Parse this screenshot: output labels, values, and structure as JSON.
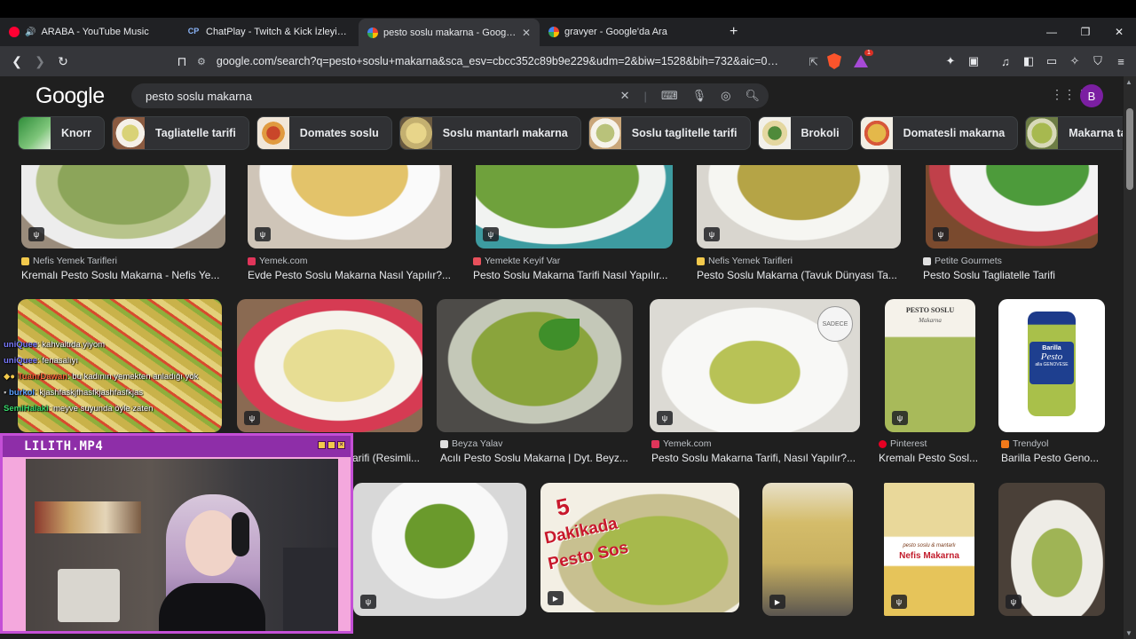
{
  "browser": {
    "tabs": [
      {
        "label": "ARABA - YouTube Music",
        "icon": "youtube-music-icon",
        "active": false
      },
      {
        "label": "ChatPlay - Twitch & Kick İzleyici Etkileşimi",
        "icon": "chatplay-icon",
        "active": false
      },
      {
        "label": "pesto soslu makarna - Google'da Ara",
        "icon": "google-icon",
        "active": true
      },
      {
        "label": "gravyer - Google'da Ara",
        "icon": "google-icon",
        "active": false
      }
    ],
    "favicon_cp": "CP",
    "new_tab": "+",
    "window_controls": {
      "minimize": "—",
      "restore": "❐",
      "close": "✕"
    },
    "url": "google.com/search?q=pesto+soslu+makarna&sca_esv=cbcc352c89b9e229&udm=2&biw=1528&bih=732&aic=0&ei=pxt...",
    "brave_badge": "4",
    "alert_badge": "1"
  },
  "google": {
    "logo": "Google",
    "query": "pesto soslu makarna",
    "avatar_letter": "B",
    "chips": [
      {
        "label": "Knorr"
      },
      {
        "label": "Tagliatelle tarifi"
      },
      {
        "label": "Domates soslu"
      },
      {
        "label": "Soslu mantarlı makarna"
      },
      {
        "label": "Soslu taglitelle tarifi"
      },
      {
        "label": "Brokoli"
      },
      {
        "label": "Domatesli makarna"
      },
      {
        "label": "Makarna tarifler"
      }
    ],
    "row1": [
      {
        "source": "Nefis Yemek Tarifleri",
        "title": "Kremalı Pesto Soslu Makarna - Nefis Ye..."
      },
      {
        "source": "Yemek.com",
        "title": "Evde Pesto Soslu Makarna Nasıl Yapılır?..."
      },
      {
        "source": "Yemekte Keyif Var",
        "title": "Pesto Soslu Makarna Tarifi Nasıl Yapılır..."
      },
      {
        "source": "Nefis Yemek Tarifleri",
        "title": "Pesto Soslu Makarna (Tavuk Dünyası Ta..."
      },
      {
        "source": "Petite Gourmets",
        "title": "Pesto Soslu Tagliatelle Tarifi"
      }
    ],
    "row2": [
      {
        "source": "",
        "title": ""
      },
      {
        "source": "",
        "title": "arifi (Resimli..."
      },
      {
        "source": "Beyza Yalav",
        "title": "Acılı Pesto Soslu Makarna | Dyt. Beyz..."
      },
      {
        "source": "Yemek.com",
        "title": "Pesto Soslu Makarna Tarifi, Nasıl Yapılır?..."
      },
      {
        "source": "Pinterest",
        "title": "Kremalı Pesto Sosl..."
      },
      {
        "source": "Trendyol",
        "title": "Barilla Pesto Geno..."
      }
    ],
    "image_text": {
      "sade_badge": "SADECE",
      "pesto_book_title": "PESTO SOSLU",
      "pesto_book_sub": "Makarna",
      "barilla": "Barilla",
      "barilla_pesto": "Pesto",
      "barilla_genovese": "alla GENOVESE",
      "video_5dk_a": "5",
      "video_5dk_b": "Dakikada",
      "video_5dk_c": "Pesto Sos",
      "mantarli_a": "pesto soslu & mantarlı",
      "mantarli_b": "Nefis Makarna"
    }
  },
  "chat": [
    {
      "user": "uniQuee",
      "message": "kahvaltıda yiyom",
      "color": "#7b7bff"
    },
    {
      "user": "uniQuee",
      "message": "fenasalıyı",
      "color": "#7b7bff"
    },
    {
      "user": "TuanrDawan",
      "message": "bu kadının yemekten anladığı yok",
      "color": "#ff6a3d"
    },
    {
      "user": "burkol",
      "message": "kjashfaskjfhasfkjashfasfkjas",
      "color": "#5aa0ff"
    },
    {
      "user": "SemiHalaki",
      "message": "meyve suyunda öyle zaten",
      "color": "#38d96b"
    }
  ],
  "cam": {
    "title": "LILITH.MP4"
  },
  "colors": {
    "accent": "#8ab4f8",
    "cam_border": "#c44fd6",
    "cam_title": "#8e2ea8",
    "cam_bg": "#f4a8dd"
  }
}
